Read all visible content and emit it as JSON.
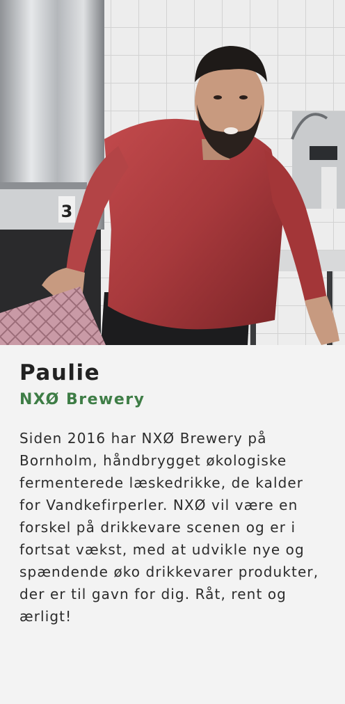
{
  "profile": {
    "photo_alt": "",
    "name": "Paulie",
    "company": "NXØ Brewery",
    "description": "Siden 2016 har NXØ Brewery på Bornholm, håndbrygget økologiske fermenterede læskedrikke, de kalder for Vandkefirperler. NXØ vil være en forskel på drikkevare scenen og er i fortsat vækst, med at udvikle nye og spændende øko drikkevarer produkter, der er til gavn for dig. Råt, rent og ærligt!",
    "tank_number": "3"
  },
  "colors": {
    "company": "#3e7d46",
    "name": "#222222",
    "shirt": "#a8393c",
    "background": "#f3f3f3"
  }
}
